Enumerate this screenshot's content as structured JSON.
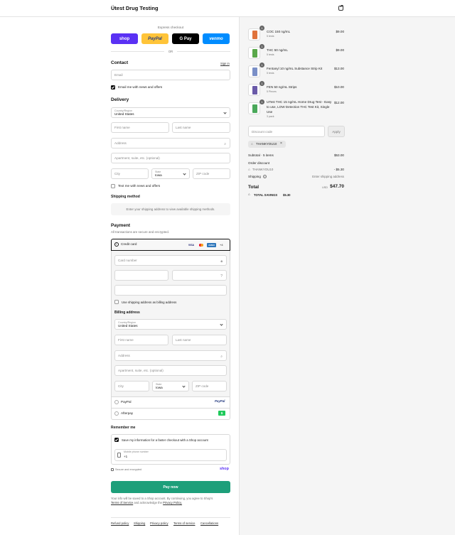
{
  "header": {
    "brand": "Ütest Drug Testing",
    "cart_icon": "shopping-bag-icon"
  },
  "express": {
    "label": "Express checkout",
    "or": "OR",
    "buttons": [
      {
        "label": "shop",
        "bg": "#5a31f4",
        "fg": "#ffffff"
      },
      {
        "label": "PayPal",
        "bg": "#ffc439",
        "fg": "#253b80"
      },
      {
        "label": "G Pay",
        "bg": "#000000",
        "fg": "#ffffff"
      },
      {
        "label": "venmo",
        "bg": "#008cff",
        "fg": "#ffffff"
      }
    ]
  },
  "contact": {
    "title": "Contact",
    "sign_in": "Sign in",
    "email_placeholder": "Email",
    "news_label": "Email me with news and offers",
    "news_checked": true
  },
  "delivery": {
    "title": "Delivery",
    "country_label": "Country/Region",
    "country_value": "United States",
    "first_name": "First name",
    "last_name": "Last name",
    "address": "Address",
    "apartment": "Apartment, suite, etc. (optional)",
    "city": "City",
    "state_label": "State",
    "state_value": "Iowa",
    "zip": "ZIP code",
    "text_label": "Text me with news and offers"
  },
  "shipping_method": {
    "title": "Shipping method",
    "notice": "Enter your shipping address to view available shipping methods."
  },
  "payment": {
    "title": "Payment",
    "subtitle": "All transactions are secure and encrypted.",
    "credit_card": "Credit card",
    "card_logos": [
      "VISA",
      "MC",
      "AMEX"
    ],
    "more_cards": "+4",
    "card_number": "Card number",
    "use_shipping": "Use shipping address as billing address",
    "billing_title": "Billing address",
    "paypal": "PayPal",
    "paypal_logo": "PayPal",
    "afterpay": "Afterpay",
    "afterpay_logo": "$"
  },
  "billing": {
    "country_label": "Country/Region",
    "country_value": "United States",
    "first_name": "First name",
    "last_name": "Last name",
    "address": "Address",
    "apartment": "Apartment, suite, etc. (optional)",
    "city": "City",
    "state_label": "State",
    "state_value": "Iowa",
    "zip": "ZIP code"
  },
  "remember": {
    "title": "Remember me",
    "save_label": "Save my information for a faster checkout with a Shop account",
    "phone_label": "Mobile phone number",
    "phone_value": "+1",
    "secure": "Secure and encrypted",
    "shop": "shop"
  },
  "pay_now": "Pay now",
  "terms": {
    "text1": "Your info will be saved to a Shop account. By continuing, you agree to Shop's",
    "tos": "Terms of Service",
    "and": "and acknowledge the",
    "privacy": "Privacy Policy."
  },
  "footer_links": [
    "Refund policy",
    "Shipping",
    "Privacy policy",
    "Terms of service",
    "Cancellations"
  ],
  "cart": {
    "items": [
      {
        "name": "COC 150 ng/mL",
        "sub": "5 tests",
        "price": "$9.00",
        "qty": "1",
        "color": "#e0733c"
      },
      {
        "name": "THC 50 ng/mL",
        "sub": "5 tests",
        "price": "$9.00",
        "qty": "1",
        "color": "#5aa84a"
      },
      {
        "name": "Fentanyl 10 ng/mL Substance Strip Kit",
        "sub": "5 tests",
        "price": "$13.00",
        "qty": "1",
        "color": "#7a8fc7"
      },
      {
        "name": "FEN 50 ng/mL Strips",
        "sub": "5 Pieces",
        "price": "$10.00",
        "qty": "1",
        "color": "#6a5aa8"
      },
      {
        "name": "UTest THC 15 ng/mL Home Drug Test - Easy to use, LOW Detection THC Test Kit, Single Use",
        "sub": "3 pack",
        "price": "$12.00",
        "qty": "1",
        "color": "#4aa85a"
      }
    ],
    "discount_placeholder": "Discount code",
    "apply": "Apply",
    "applied_code": "THANKYOU10",
    "subtotal_label": "Subtotal · 5 items",
    "subtotal": "$53.00",
    "order_discount": "Order discount",
    "discount_code": "THANKYOU10",
    "discount_amount": "- $5.30",
    "shipping_label": "Shipping",
    "shipping_value": "Enter shipping address",
    "total_label": "Total",
    "currency": "USD",
    "total": "$47.70",
    "savings_label": "TOTAL SAVINGS",
    "savings": "$5.30"
  }
}
